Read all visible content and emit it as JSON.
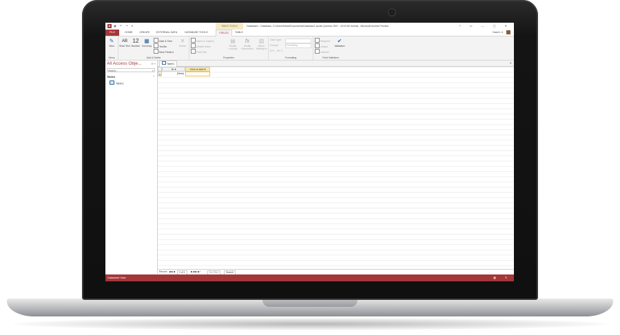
{
  "window": {
    "title": "Database1 : Database- C:\\Users\\David\\Documents\\Database1.accdb (Access 2007 - 2013 file format) - Microsoft Access Preview",
    "app_logo": "A",
    "qat_icons": "▣ ↶ ↷ ▾",
    "context_group": "TABLE TOOLS",
    "controls": "? ▭ — ▢ ✕"
  },
  "tabs": [
    "FILE",
    "HOME",
    "CREATE",
    "EXTERNAL DATA",
    "DATABASE TOOLS",
    "FIELDS",
    "TABLE"
  ],
  "active_tab": "FIELDS",
  "user": "David L ▾",
  "ribbon": {
    "views": {
      "label": "Views",
      "view_btn": "View"
    },
    "add_delete": {
      "label": "Add & Delete",
      "short_text": "Short Text",
      "number_big": "12",
      "number": "Number",
      "currency": "Currency",
      "date_time": "Date & Time",
      "yes_no": "Yes/No",
      "more_fields": "More Fields ▾",
      "delete": "Delete"
    },
    "properties": {
      "label": "Properties",
      "name_caption": "Name & Caption",
      "default_value": "Default Value",
      "field_size": "Field Size",
      "modify_lookups": "Modify Lookups",
      "modify_expression": "Modify Expression",
      "memo_settings": "Memo Settings ▾"
    },
    "formatting": {
      "label": "Formatting",
      "data_type": "Data Type:",
      "format": "Format:",
      "format_value": "Formatting",
      "symbols": "$ % ,  .00 .0"
    },
    "field_validation": {
      "label": "Field Validation",
      "required": "Required",
      "unique": "Unique",
      "indexed": "Indexed",
      "validation": "Validation"
    }
  },
  "nav": {
    "title": "All Access Obje...",
    "controls": "⊙ «",
    "search_placeholder": "Search...",
    "group": "Tables",
    "items": [
      "Table1"
    ]
  },
  "doc": {
    "tab": "Table1",
    "close": "✕",
    "columns": [
      "ID",
      "Click to Add"
    ],
    "new_row": "(New)"
  },
  "record_nav": {
    "label": "Record: ",
    "first_prev": "◀◀ ◀",
    "position": "1 of 1",
    "next_last": "▶ ▶▶ ▶*",
    "filter": "No Filter",
    "search": "Search"
  },
  "status": {
    "text": "Datasheet View",
    "icons": "▦ ✎"
  },
  "colors": {
    "accent": "#a4373a",
    "column_add": "#fbe7a6"
  }
}
